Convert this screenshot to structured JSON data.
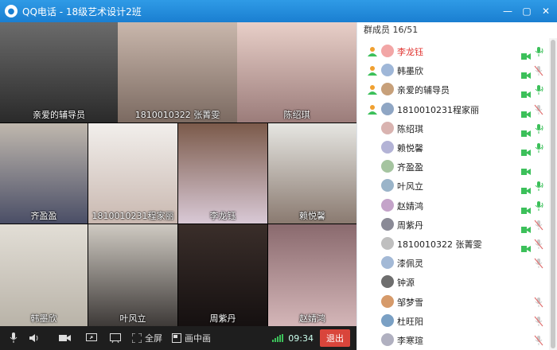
{
  "window": {
    "title": "QQ电话 - 18级艺术设计2班"
  },
  "panel": {
    "title": "群成员 16/51"
  },
  "tiles": [
    {
      "name": "亲爱的辅导员",
      "bg": "#4a4a4a"
    },
    {
      "name": "1810010322 张菁雯",
      "bg": "#b9a79c"
    },
    {
      "name": "陈绍琪",
      "bg": "#d7b7b0"
    },
    {
      "name": "齐盈盈",
      "bg": "#a8a29a"
    },
    {
      "name": "1810010231程家丽",
      "bg": "#e8e4e0"
    },
    {
      "name": "李龙钰",
      "bg": "#c7a9b0"
    },
    {
      "name": "赖悦馨",
      "bg": "#d0d0cc"
    },
    {
      "name": "韩墨欣",
      "bg": "#d4d0c8"
    },
    {
      "name": "叶风立",
      "bg": "#b9b5ae"
    },
    {
      "name": "周紫丹",
      "bg": "#2a2220"
    },
    {
      "name": "赵婧鸿",
      "bg": "#6a5a5c"
    }
  ],
  "toolbar": {
    "fullscreen_label": "全屏",
    "pip_label": "画中画",
    "time": "09:34",
    "exit_label": "退出"
  },
  "members": [
    {
      "name": "李龙钰",
      "host": true,
      "badge": true,
      "avatar": "#f2a6a6",
      "cam": "on",
      "mic": "on"
    },
    {
      "name": "韩墨欣",
      "host": false,
      "badge": true,
      "avatar": "#9fb7d8",
      "cam": "on",
      "mic": "muted"
    },
    {
      "name": "亲爱的辅导员",
      "host": false,
      "badge": true,
      "avatar": "#c7a07a",
      "cam": "on",
      "mic": "on"
    },
    {
      "name": "1810010231程家丽",
      "host": false,
      "badge": true,
      "avatar": "#8fa6c4",
      "cam": "on",
      "mic": "muted"
    },
    {
      "name": "陈绍琪",
      "host": false,
      "badge": false,
      "avatar": "#d9b3b0",
      "cam": "on",
      "mic": "on"
    },
    {
      "name": "赖悦馨",
      "host": false,
      "badge": false,
      "avatar": "#b3b3d6",
      "cam": "on",
      "mic": "on"
    },
    {
      "name": "齐盈盈",
      "host": false,
      "badge": false,
      "avatar": "#a5c4a0",
      "cam": "on",
      "mic": "none"
    },
    {
      "name": "叶风立",
      "host": false,
      "badge": false,
      "avatar": "#9ab4c9",
      "cam": "on",
      "mic": "on"
    },
    {
      "name": "赵婧鸿",
      "host": false,
      "badge": false,
      "avatar": "#c4a3c9",
      "cam": "on",
      "mic": "on"
    },
    {
      "name": "周紫丹",
      "host": false,
      "badge": false,
      "avatar": "#8a8a96",
      "cam": "on",
      "mic": "muted"
    },
    {
      "name": "1810010322 张菁雯",
      "host": false,
      "badge": false,
      "avatar": "#bfbfbf",
      "cam": "on",
      "mic": "muted"
    },
    {
      "name": "漆佩灵",
      "host": false,
      "badge": false,
      "avatar": "#a3b9d6",
      "cam": "none",
      "mic": "muted"
    },
    {
      "name": "钟源",
      "host": false,
      "badge": false,
      "avatar": "#6e6e6e",
      "cam": "none",
      "mic": "none"
    },
    {
      "name": "邹梦雪",
      "host": false,
      "badge": false,
      "avatar": "#d69a6a",
      "cam": "none",
      "mic": "muted"
    },
    {
      "name": "杜旺阳",
      "host": false,
      "badge": false,
      "avatar": "#7aa0c4",
      "cam": "none",
      "mic": "muted"
    },
    {
      "name": "李寒瑄",
      "host": false,
      "badge": false,
      "avatar": "#b0b0c0",
      "cam": "none",
      "mic": "muted"
    }
  ],
  "colors": {
    "accent": "#1a7fd1",
    "host_name": "#e0322e",
    "cam_on": "#3cc05a",
    "exit": "#d9453b"
  }
}
